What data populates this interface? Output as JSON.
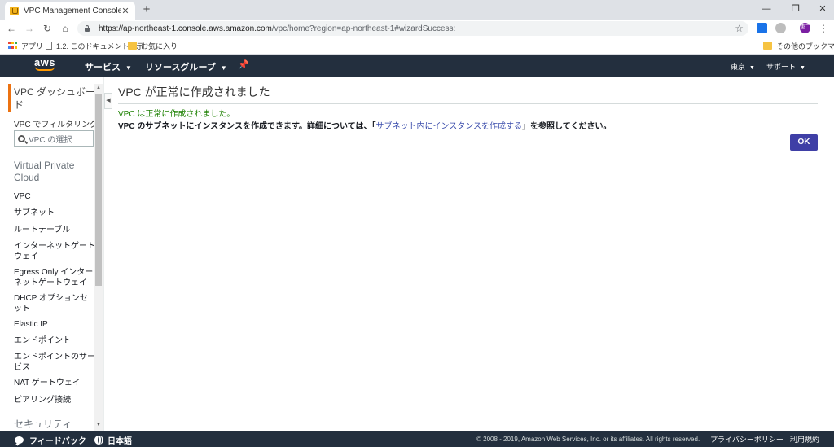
{
  "browser": {
    "tab_title": "VPC Management Console",
    "tab_close": "✕",
    "new_tab": "+",
    "url_host": "https://ap-northeast-1.console.aws.amazon.com",
    "url_path": "/vpc/home?region=ap-northeast-1#wizardSuccess:",
    "bookmarks": [
      "アプリ",
      "1.2. このドキュメントが示",
      "お気に入り"
    ],
    "other_bookmarks": "その他のブックマーク",
    "profile_initials": "重二"
  },
  "aws_header": {
    "logo_text": "aws",
    "services": "サービス",
    "resource_groups": "リソースグループ",
    "region": "東京",
    "support": "サポート"
  },
  "sidebar": {
    "title": "VPC ダッシュボード",
    "filter_label": "VPC でフィルタリング:",
    "search_placeholder": "VPC の選択",
    "section": "Virtual Private Cloud",
    "items": [
      "VPC",
      "サブネット",
      "ルートテーブル",
      "インターネットゲートウェイ",
      "Egress Only インターネットゲートウェイ",
      "DHCP オプションセット",
      "Elastic IP",
      "エンドポイント",
      "エンドポイントのサービス",
      "NAT ゲートウェイ",
      "ピアリング接続"
    ],
    "next_section": "セキュリティ"
  },
  "main": {
    "title": "VPC が正常に作成されました",
    "success_message": "VPC は正常に作成されました。",
    "detail_prefix": "VPC のサブネットにインスタンスを作成できます。詳細については、「",
    "detail_link": "サブネット内にインスタンスを作成する",
    "detail_suffix": "」を参照してください。",
    "ok_button": "OK"
  },
  "footer": {
    "feedback": "フィードバック",
    "language": "日本語",
    "copyright": "© 2008 - 2019, Amazon Web Services, Inc. or its affiliates. All rights reserved.",
    "privacy": "プライバシーポリシー",
    "terms": "利用規約"
  },
  "colors": {
    "aws_nav": "#232f3e",
    "accent": "#ec7211",
    "success": "#1d8102",
    "primary_button": "#3f3fa6",
    "link": "#3b4dac"
  }
}
